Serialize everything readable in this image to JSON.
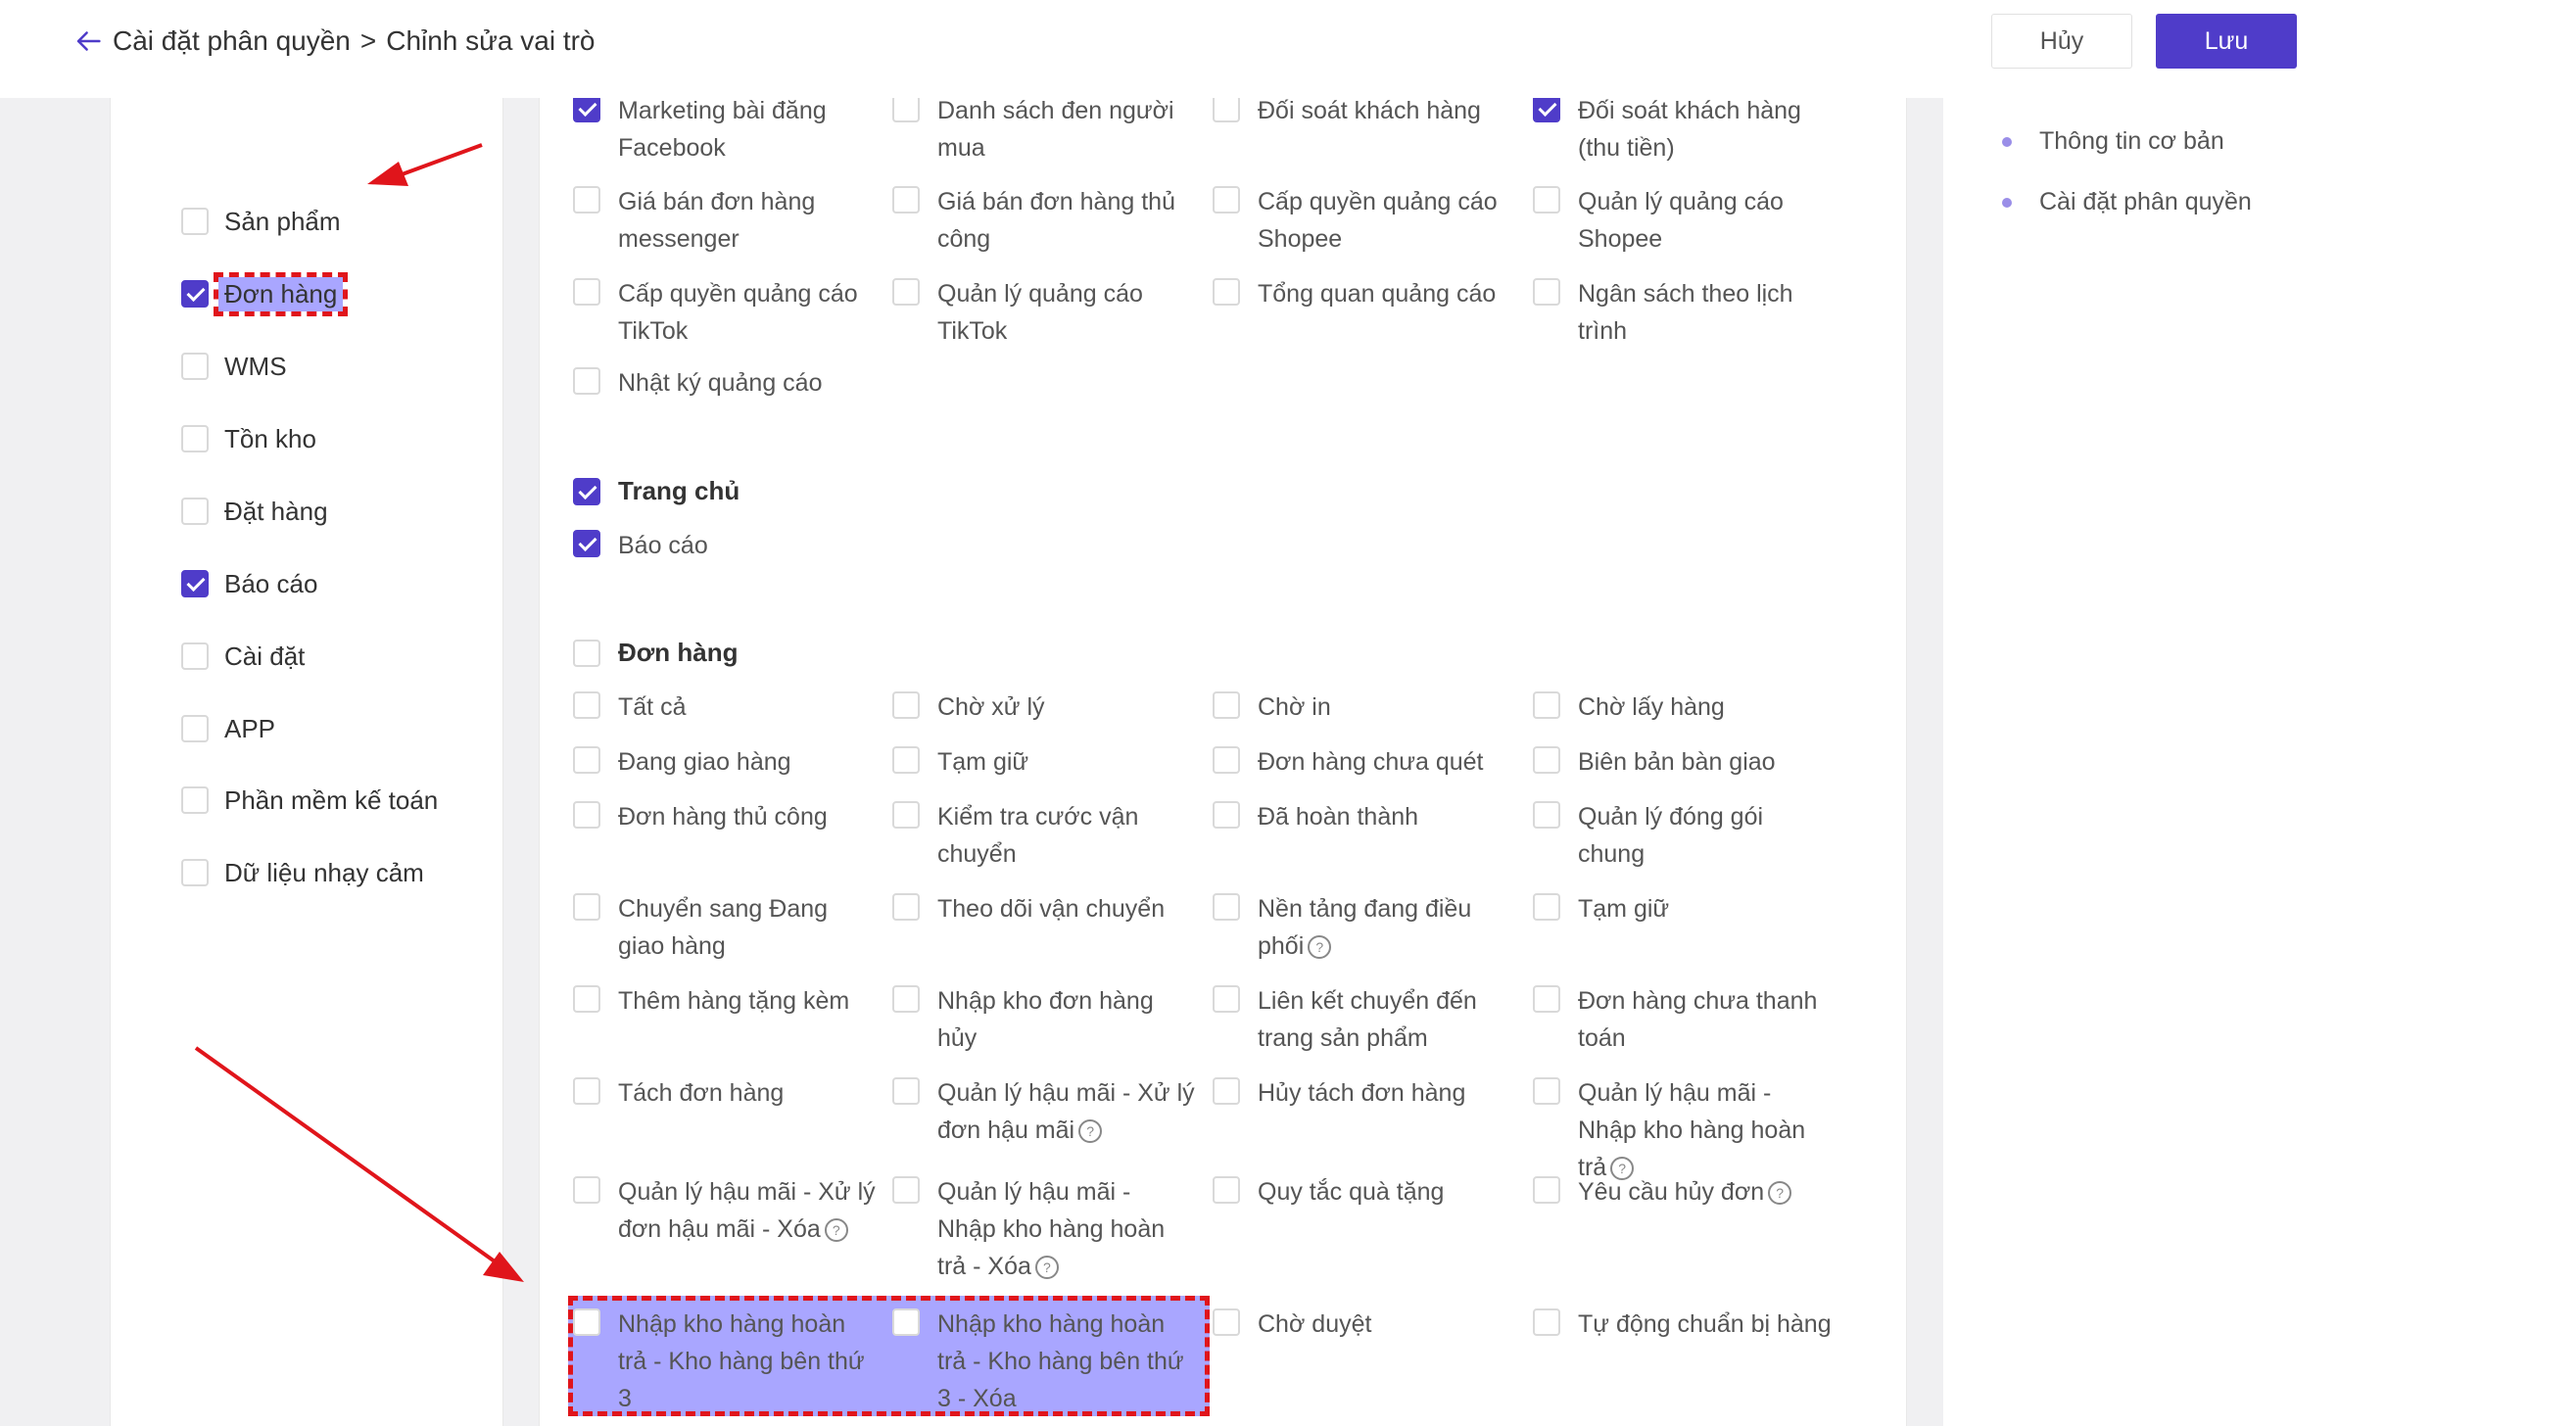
{
  "header": {
    "back_icon": "arrow-left-icon",
    "breadcrumb_parent": "Cài đặt phân quyền",
    "breadcrumb_sep": ">",
    "breadcrumb_current": "Chỉnh sửa vai trò",
    "cancel_label": "Hủy",
    "save_label": "Lưu"
  },
  "colors": {
    "accent": "#4f3cc9",
    "highlight": "#a9a6ff",
    "annotation": "#e0151b"
  },
  "categories": [
    {
      "label": "Sản phẩm",
      "checked": false
    },
    {
      "label": "Đơn hàng",
      "checked": true
    },
    {
      "label": "WMS",
      "checked": false
    },
    {
      "label": "Tồn kho",
      "checked": false
    },
    {
      "label": "Đặt hàng",
      "checked": false
    },
    {
      "label": "Báo cáo",
      "checked": true
    },
    {
      "label": "Cài đặt",
      "checked": false
    },
    {
      "label": "APP",
      "checked": false
    },
    {
      "label": "Phần mềm kế toán",
      "checked": false
    },
    {
      "label": "Dữ liệu nhạy cảm",
      "checked": false
    }
  ],
  "marketing": {
    "items": [
      {
        "label": "Marketing bài đăng Facebook",
        "checked": true
      },
      {
        "label": "Danh sách đen người mua",
        "checked": false
      },
      {
        "label": "Đối soát khách hàng",
        "checked": false
      },
      {
        "label": "Đối soát khách hàng (thu tiền)",
        "checked": true
      },
      {
        "label": "Giá bán đơn hàng messenger",
        "checked": false
      },
      {
        "label": "Giá bán đơn hàng thủ công",
        "checked": false
      },
      {
        "label": "Cấp quyền quảng cáo Shopee",
        "checked": false
      },
      {
        "label": "Quản lý quảng cáo Shopee",
        "checked": false
      },
      {
        "label": "Cấp quyền quảng cáo TikTok",
        "checked": false
      },
      {
        "label": "Quản lý quảng cáo TikTok",
        "checked": false
      },
      {
        "label": "Tổng quan quảng cáo",
        "checked": false
      },
      {
        "label": "Ngân sách theo lịch trình",
        "checked": false
      },
      {
        "label": "Nhật ký quảng cáo",
        "checked": false
      }
    ]
  },
  "home_group": {
    "title": "Trang chủ",
    "checked": true,
    "items": [
      {
        "label": "Báo cáo",
        "checked": true
      }
    ]
  },
  "order_group": {
    "title": "Đơn hàng",
    "checked": false,
    "items": [
      {
        "label": "Tất cả",
        "checked": false
      },
      {
        "label": "Chờ xử lý",
        "checked": false
      },
      {
        "label": "Chờ in",
        "checked": false
      },
      {
        "label": "Chờ lấy hàng",
        "checked": false
      },
      {
        "label": "Đang giao hàng",
        "checked": false
      },
      {
        "label": "Tạm giữ",
        "checked": false
      },
      {
        "label": "Đơn hàng chưa quét",
        "checked": false
      },
      {
        "label": "Biên bản bàn giao",
        "checked": false
      },
      {
        "label": "Đơn hàng thủ công",
        "checked": false
      },
      {
        "label": "Kiểm tra cước vận chuyển",
        "checked": false
      },
      {
        "label": "Đã hoàn thành",
        "checked": false
      },
      {
        "label": "Quản lý đóng gói chung",
        "checked": false
      },
      {
        "label": "Chuyển sang Đang giao hàng",
        "checked": false
      },
      {
        "label": "Theo dõi vận chuyển",
        "checked": false
      },
      {
        "label": "Nền tảng đang điều phối",
        "checked": false,
        "help": true
      },
      {
        "label": "Tạm giữ",
        "checked": false
      },
      {
        "label": "Thêm hàng tặng kèm",
        "checked": false
      },
      {
        "label": "Nhập kho đơn hàng hủy",
        "checked": false
      },
      {
        "label": "Liên kết chuyển đến trang sản phẩm",
        "checked": false
      },
      {
        "label": "Đơn hàng chưa thanh toán",
        "checked": false
      },
      {
        "label": "Tách đơn hàng",
        "checked": false
      },
      {
        "label": "Quản lý hậu mãi - Xử lý đơn hậu mãi",
        "checked": false,
        "help": true
      },
      {
        "label": "Hủy tách đơn hàng",
        "checked": false
      },
      {
        "label": "Quản lý hậu mãi - Nhập kho hàng hoàn trả",
        "checked": false,
        "help": true
      },
      {
        "label": "Quản lý hậu mãi - Xử lý đơn hậu mãi - Xóa",
        "checked": false,
        "help": true
      },
      {
        "label": "Quản lý hậu mãi - Nhập kho hàng hoàn trả - Xóa",
        "checked": false,
        "help": true
      },
      {
        "label": "Quy tắc quà tặng",
        "checked": false
      },
      {
        "label": "Yêu cầu hủy đơn",
        "checked": false,
        "help": true
      },
      {
        "label": "Nhập kho hàng hoàn trả - Kho hàng bên thứ 3",
        "checked": false
      },
      {
        "label": "Nhập kho hàng hoàn trả - Kho hàng bên thứ 3 - Xóa",
        "checked": false
      },
      {
        "label": "Chờ duyệt",
        "checked": false
      },
      {
        "label": "Tự động chuẩn bị hàng",
        "checked": false
      }
    ]
  },
  "right_nav": [
    {
      "label": "Thông tin cơ bản"
    },
    {
      "label": "Cài đặt phân quyền"
    }
  ]
}
